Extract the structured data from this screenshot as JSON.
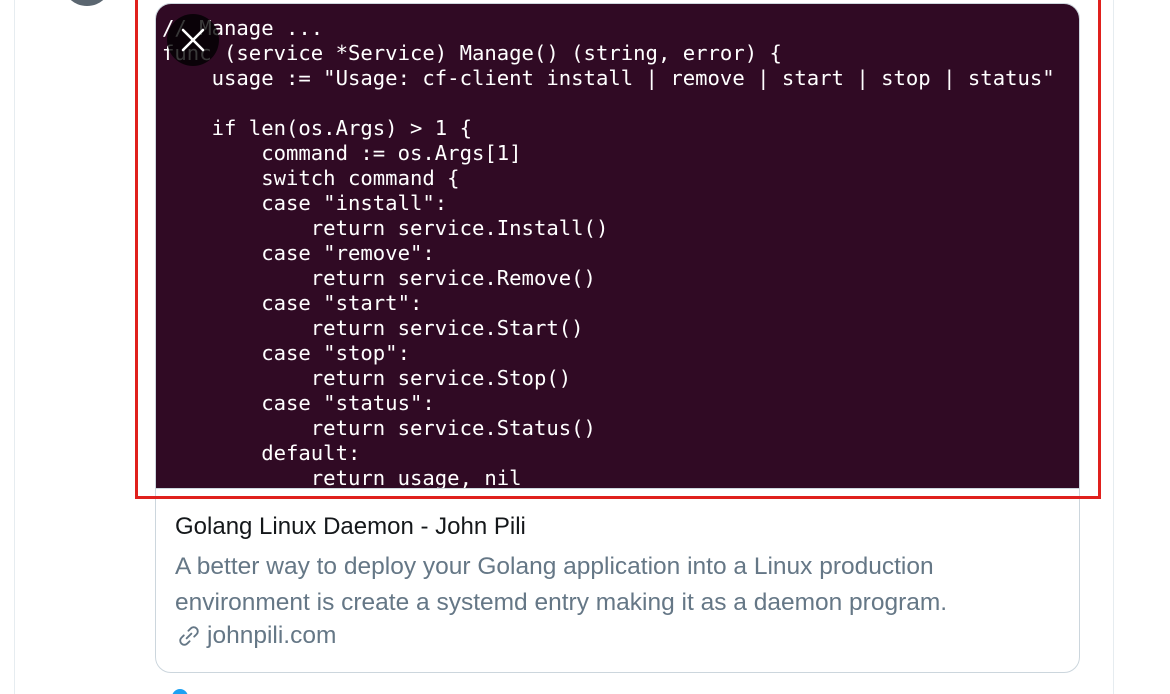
{
  "card": {
    "code_lines": [
      "// Manage ...",
      "func (service *Service) Manage() (string, error) {",
      "    usage := \"Usage: cf-client install | remove | start | stop | status\"",
      "",
      "    if len(os.Args) > 1 {",
      "        command := os.Args[1]",
      "        switch command {",
      "        case \"install\":",
      "            return service.Install()",
      "        case \"remove\":",
      "            return service.Remove()",
      "        case \"start\":",
      "            return service.Start()",
      "        case \"stop\":",
      "            return service.Stop()",
      "        case \"status\":",
      "            return service.Status()",
      "        default:",
      "            return usage, nil"
    ],
    "title": "Golang Linux Daemon - John Pili",
    "description": "A better way to deploy your Golang application into a Linux production environment is create a systemd entry making it as a daemon program.",
    "domain": "johnpili.com",
    "close_icon": "close-icon",
    "link_icon": "link-icon"
  },
  "colors": {
    "code_background": "#300a24",
    "highlight_border": "#e0201d",
    "muted_text": "#657786",
    "accent": "#1da1f2"
  }
}
